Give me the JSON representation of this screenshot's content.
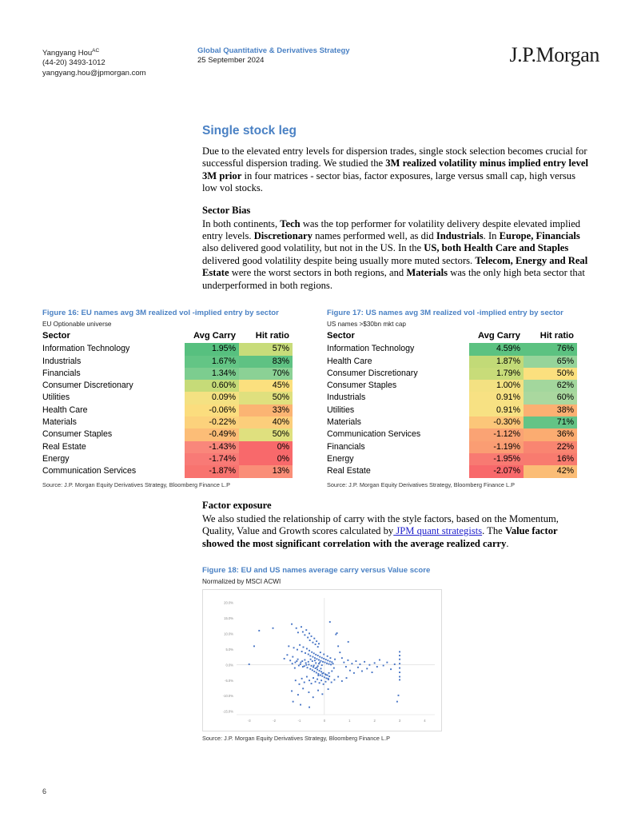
{
  "header": {
    "author_name": "Yangyang Hou",
    "author_sup": "AC",
    "phone": "(44-20) 3493-1012",
    "email": "yangyang.hou@jpmorgan.com",
    "strategy": "Global Quantitative & Derivatives Strategy",
    "date": "25 September 2024",
    "logo": "J.P.Morgan"
  },
  "content": {
    "section_title": "Single stock leg",
    "para1_a": "Due to the elevated entry levels for dispersion trades, single stock selection becomes crucial for successful dispersion trading. We studied the ",
    "para1_b": "3M realized volatility minus implied entry level 3M prior",
    "para1_c": " in four matrices - sector bias, factor exposures, large versus small cap, high versus low vol stocks.",
    "sector_bias_heading": "Sector Bias",
    "sb_1": "In both continents, ",
    "sb_2": "Tech",
    "sb_3": " was the top performer for volatility delivery despite elevated implied entry levels. ",
    "sb_4": "Discretionary",
    "sb_5": " names performed well, as did ",
    "sb_6": "Industrials",
    "sb_7": ". In ",
    "sb_8": "Europe, Financials",
    "sb_9": " also delivered good volatility, but not in the US. In the ",
    "sb_10": "US, both Health Care and Staples",
    "sb_11": " delivered good volatility despite being usually more muted sectors. ",
    "sb_12": "Telecom, Energy and Real Estate",
    "sb_13": " were the worst sectors in both regions, and ",
    "sb_14": "Materials",
    "sb_15": " was the only high beta sector that underperformed in both regions.",
    "factor_heading": "Factor exposure",
    "fe_1": "We also studied the relationship of carry with the style factors, based on the Momentum, Quality, Value and Growth scores calculated by",
    "fe_link": " JPM quant strategists",
    "fe_2": ". The ",
    "fe_3": "Value factor showed the most significant correlation with the average realized carry",
    "fe_4": "."
  },
  "figure16": {
    "title": "Figure 16: EU names avg 3M realized vol -implied entry by sector",
    "subtitle": "EU Optionable universe",
    "source": "Source: J.P. Morgan Equity Derivatives Strategy, Bloomberg Finance L.P",
    "columns": [
      "Sector",
      "Avg Carry",
      "Hit ratio"
    ],
    "rows": [
      {
        "sector": "Information Technology",
        "carry": "1.95%",
        "hit": "57%",
        "carry_color": "#57c07f",
        "hit_color": "#c8dc7a"
      },
      {
        "sector": "Industrials",
        "carry": "1.67%",
        "hit": "83%",
        "carry_color": "#63c585",
        "hit_color": "#5fc283"
      },
      {
        "sector": "Financials",
        "carry": "1.34%",
        "hit": "70%",
        "carry_color": "#7ccd8f",
        "hit_color": "#8bd195"
      },
      {
        "sector": "Consumer Discretionary",
        "carry": "0.60%",
        "hit": "45%",
        "carry_color": "#c6db78",
        "hit_color": "#fbe07e"
      },
      {
        "sector": "Utilities",
        "carry": "0.09%",
        "hit": "50%",
        "carry_color": "#f4e182",
        "hit_color": "#dfe07e"
      },
      {
        "sector": "Health Care",
        "carry": "-0.06%",
        "hit": "33%",
        "carry_color": "#fbdd7e",
        "hit_color": "#fbb473"
      },
      {
        "sector": "Materials",
        "carry": "-0.22%",
        "hit": "40%",
        "carry_color": "#fcd27c",
        "hit_color": "#fcce7b"
      },
      {
        "sector": "Consumer Staples",
        "carry": "-0.49%",
        "hit": "50%",
        "carry_color": "#fcbd77",
        "hit_color": "#dfe07e"
      },
      {
        "sector": "Real Estate",
        "carry": "-1.43%",
        "hit": "0%",
        "carry_color": "#f9877b",
        "hit_color": "#f8696b"
      },
      {
        "sector": "Energy",
        "carry": "-1.74%",
        "hit": "0%",
        "carry_color": "#f87a76",
        "hit_color": "#f8696b"
      },
      {
        "sector": "Communication Services",
        "carry": "-1.87%",
        "hit": "13%",
        "carry_color": "#f8736f",
        "hit_color": "#fa8e78"
      }
    ]
  },
  "figure17": {
    "title": "Figure 17: US names avg 3M realized vol -implied entry by sector",
    "subtitle": "US names >$30bn mkt cap",
    "source": "Source: J.P. Morgan Equity Derivatives Strategy, Bloomberg Finance L.P",
    "columns": [
      "Sector",
      "Avg Carry",
      "Hit ratio"
    ],
    "rows": [
      {
        "sector": "Information Technology",
        "carry": "4.59%",
        "hit": "76%",
        "carry_color": "#5cc281",
        "hit_color": "#5cc281"
      },
      {
        "sector": "Health Care",
        "carry": "1.87%",
        "hit": "65%",
        "carry_color": "#c2da77",
        "hit_color": "#96d49a"
      },
      {
        "sector": "Consumer Discretionary",
        "carry": "1.79%",
        "hit": "50%",
        "carry_color": "#c8dc79",
        "hit_color": "#fbe07e"
      },
      {
        "sector": "Consumer Staples",
        "carry": "1.00%",
        "hit": "62%",
        "carry_color": "#f3e182",
        "hit_color": "#a3d79d"
      },
      {
        "sector": "Industrials",
        "carry": "0.91%",
        "hit": "60%",
        "carry_color": "#f7e183",
        "hit_color": "#aad89f"
      },
      {
        "sector": "Utilities",
        "carry": "0.91%",
        "hit": "38%",
        "carry_color": "#f7e183",
        "hit_color": "#fbb072"
      },
      {
        "sector": "Materials",
        "carry": "-0.30%",
        "hit": "71%",
        "carry_color": "#fcc679",
        "hit_color": "#64c486"
      },
      {
        "sector": "Communication Services",
        "carry": "-1.12%",
        "hit": "36%",
        "carry_color": "#faa374",
        "hit_color": "#fbac71"
      },
      {
        "sector": "Financials",
        "carry": "-1.19%",
        "hit": "22%",
        "carry_color": "#fa9d73",
        "hit_color": "#f98571"
      },
      {
        "sector": "Energy",
        "carry": "-1.95%",
        "hit": "16%",
        "carry_color": "#f87a72",
        "hit_color": "#f87b6f"
      },
      {
        "sector": "Real Estate",
        "carry": "-2.07%",
        "hit": "42%",
        "carry_color": "#f8696b",
        "hit_color": "#fbbd76"
      }
    ]
  },
  "figure18": {
    "title": "Figure 18: EU and US names average carry versus Value score",
    "subtitle": "Normalized by MSCI ACWI",
    "source": "Source: J.P. Morgan Equity Derivatives Strategy, Bloomberg Finance L.P"
  },
  "chart_data": {
    "type": "scatter",
    "title": "Figure 18: EU and US names average carry versus Value score",
    "subtitle": "Normalized by MSCI ACWI",
    "xlabel": "",
    "ylabel": "",
    "xlim": [
      -3.5,
      4.4
    ],
    "ylim": [
      -0.16,
      0.215
    ],
    "xticks": [
      -3,
      -2,
      -1,
      0,
      1,
      2,
      3,
      4
    ],
    "xtick_labels": [
      "-3",
      "-2",
      "-1",
      "0",
      "1",
      "2",
      "3",
      "4"
    ],
    "yticks": [
      0.2,
      0.15,
      0.1,
      0.05,
      0.0,
      -0.05,
      -0.1,
      -0.15
    ],
    "ytick_labels": [
      "20.0%",
      "15.0%",
      "10.0%",
      "5.0%",
      "0.0%",
      "-5.0%",
      "-10.0%",
      "-15.0%"
    ],
    "grid": false,
    "marker_color": "#4472c4",
    "marker_size": 1.9,
    "legend": null,
    "series": [
      {
        "name": "Stocks",
        "points": [
          [
            -2.05,
            0.118
          ],
          [
            -1.3,
            0.131
          ],
          [
            -1.12,
            0.118
          ],
          [
            -1.05,
            0.104
          ],
          [
            -0.92,
            0.122
          ],
          [
            -0.86,
            0.106
          ],
          [
            -0.78,
            0.096
          ],
          [
            -0.72,
            0.112
          ],
          [
            -0.66,
            0.088
          ],
          [
            -0.6,
            0.101
          ],
          [
            -0.58,
            0.079
          ],
          [
            -0.52,
            0.092
          ],
          [
            -0.46,
            0.072
          ],
          [
            -0.4,
            0.085
          ],
          [
            -0.36,
            0.066
          ],
          [
            -0.31,
            0.076
          ],
          [
            -0.26,
            0.058
          ],
          [
            -0.22,
            0.068
          ],
          [
            0.22,
            0.138
          ],
          [
            0.46,
            0.098
          ],
          [
            -1.42,
            0.06
          ],
          [
            -1.22,
            0.055
          ],
          [
            -1.08,
            0.049
          ],
          [
            -0.98,
            0.064
          ],
          [
            -0.9,
            0.043
          ],
          [
            -0.84,
            0.057
          ],
          [
            -0.76,
            0.038
          ],
          [
            -0.7,
            0.052
          ],
          [
            -0.64,
            0.034
          ],
          [
            -0.6,
            0.046
          ],
          [
            -0.56,
            0.029
          ],
          [
            -0.5,
            0.041
          ],
          [
            -0.46,
            0.026
          ],
          [
            -0.42,
            0.037
          ],
          [
            -0.38,
            0.022
          ],
          [
            -0.34,
            0.033
          ],
          [
            -0.3,
            0.019
          ],
          [
            -0.26,
            0.03
          ],
          [
            -0.22,
            0.016
          ],
          [
            -0.18,
            0.026
          ],
          [
            -0.14,
            0.013
          ],
          [
            -0.1,
            0.023
          ],
          [
            -0.06,
            0.01
          ],
          [
            -0.02,
            0.02
          ],
          [
            0.02,
            0.008
          ],
          [
            0.06,
            0.017
          ],
          [
            0.1,
            0.005
          ],
          [
            0.14,
            0.014
          ],
          [
            0.18,
            0.003
          ],
          [
            0.22,
            0.011
          ],
          [
            0.26,
            0.001
          ],
          [
            0.3,
            0.009
          ],
          [
            -1.6,
            0.02
          ],
          [
            -1.48,
            0.032
          ],
          [
            -1.36,
            0.014
          ],
          [
            -1.26,
            0.026
          ],
          [
            -1.16,
            0.008
          ],
          [
            -1.06,
            0.018
          ],
          [
            -0.96,
            0.002
          ],
          [
            -0.88,
            0.012
          ],
          [
            -0.8,
            -0.004
          ],
          [
            -0.74,
            0.006
          ],
          [
            -0.68,
            -0.009
          ],
          [
            -0.62,
            0.001
          ],
          [
            -0.56,
            -0.013
          ],
          [
            -0.52,
            -0.003
          ],
          [
            -0.48,
            -0.017
          ],
          [
            -0.44,
            -0.007
          ],
          [
            -0.4,
            -0.021
          ],
          [
            -0.36,
            -0.011
          ],
          [
            -0.32,
            -0.025
          ],
          [
            -0.28,
            -0.015
          ],
          [
            -0.24,
            -0.029
          ],
          [
            -0.2,
            -0.019
          ],
          [
            -0.16,
            -0.033
          ],
          [
            -0.12,
            -0.022
          ],
          [
            -0.08,
            -0.036
          ],
          [
            -0.04,
            -0.026
          ],
          [
            0.0,
            -0.04
          ],
          [
            0.04,
            -0.03
          ],
          [
            0.08,
            -0.043
          ],
          [
            0.12,
            -0.033
          ],
          [
            0.16,
            -0.047
          ],
          [
            0.2,
            -0.037
          ],
          [
            -2.6,
            0.11
          ],
          [
            -2.8,
            0.06
          ],
          [
            -3.0,
            0.002
          ],
          [
            0.55,
            0.06
          ],
          [
            0.62,
            0.04
          ],
          [
            0.7,
            0.022
          ],
          [
            0.78,
            0.008
          ],
          [
            0.86,
            -0.006
          ],
          [
            0.94,
            0.015
          ],
          [
            1.02,
            -0.018
          ],
          [
            1.1,
            0.004
          ],
          [
            1.18,
            -0.026
          ],
          [
            1.26,
            0.012
          ],
          [
            1.34,
            -0.008
          ],
          [
            1.42,
            0.002
          ],
          [
            1.5,
            -0.02
          ],
          [
            1.6,
            0.01
          ],
          [
            1.7,
            -0.012
          ],
          [
            1.8,
            0.0
          ],
          [
            1.9,
            -0.024
          ],
          [
            2.0,
            0.006
          ],
          [
            2.1,
            -0.006
          ],
          [
            2.2,
            0.016
          ],
          [
            2.35,
            -0.002
          ],
          [
            2.5,
            0.008
          ],
          [
            2.65,
            -0.014
          ],
          [
            2.8,
            0.002
          ],
          [
            3.0,
            0.042
          ],
          [
            3.0,
            0.03
          ],
          [
            3.0,
            0.018
          ],
          [
            3.0,
            0.004
          ],
          [
            3.0,
            -0.01
          ],
          [
            3.0,
            -0.024
          ],
          [
            3.0,
            -0.038
          ],
          [
            3.0,
            -0.048
          ],
          [
            0.5,
            0.102
          ],
          [
            0.95,
            0.074
          ],
          [
            -1.15,
            -0.05
          ],
          [
            -1.0,
            -0.062
          ],
          [
            -0.9,
            -0.044
          ],
          [
            -0.8,
            -0.056
          ],
          [
            -0.7,
            -0.038
          ],
          [
            -0.6,
            -0.05
          ],
          [
            -0.52,
            -0.06
          ],
          [
            -0.44,
            -0.042
          ],
          [
            -0.36,
            -0.054
          ],
          [
            -0.28,
            -0.046
          ],
          [
            -0.2,
            -0.058
          ],
          [
            -0.12,
            -0.05
          ],
          [
            -0.04,
            -0.062
          ],
          [
            0.05,
            -0.054
          ],
          [
            0.15,
            -0.044
          ],
          [
            0.28,
            -0.056
          ],
          [
            0.4,
            -0.048
          ],
          [
            0.55,
            -0.038
          ],
          [
            0.7,
            -0.052
          ],
          [
            0.88,
            -0.042
          ],
          [
            -1.3,
            -0.084
          ],
          [
            -1.05,
            -0.096
          ],
          [
            -0.85,
            -0.076
          ],
          [
            -0.62,
            -0.088
          ],
          [
            -0.45,
            -0.104
          ],
          [
            -0.25,
            -0.082
          ],
          [
            -0.08,
            -0.094
          ],
          [
            0.15,
            -0.078
          ],
          [
            -0.95,
            -0.128
          ],
          [
            -1.25,
            -0.118
          ],
          [
            -0.6,
            -0.136
          ],
          [
            2.95,
            -0.098
          ],
          [
            2.9,
            -0.118
          ],
          [
            -0.48,
            0.012
          ],
          [
            -0.42,
            -0.002
          ],
          [
            -0.34,
            0.006
          ],
          [
            -0.26,
            -0.004
          ],
          [
            -0.18,
            0.008
          ],
          [
            -0.1,
            -0.001
          ],
          [
            -0.55,
            0.018
          ],
          [
            -0.64,
            0.01
          ],
          [
            -0.72,
            0.0
          ],
          [
            -0.78,
            0.016
          ],
          [
            -0.86,
            -0.006
          ],
          [
            -0.94,
            0.008
          ],
          [
            -1.02,
            -0.002
          ],
          [
            -1.1,
            0.012
          ],
          [
            -1.18,
            -0.01
          ],
          [
            -1.28,
            0.004
          ],
          [
            -0.38,
            0.014
          ],
          [
            -0.3,
            -0.008
          ],
          [
            -0.22,
            0.004
          ],
          [
            -0.14,
            -0.012
          ],
          [
            0.34,
            0.004
          ],
          [
            0.38,
            -0.01
          ],
          [
            0.42,
            0.018
          ],
          [
            0.3,
            -0.02
          ],
          [
            0.24,
            0.022
          ],
          [
            0.18,
            -0.026
          ],
          [
            0.12,
            0.028
          ],
          [
            0.06,
            -0.032
          ],
          [
            -0.02,
            0.034
          ],
          [
            -0.08,
            -0.028
          ],
          [
            -0.16,
            0.04
          ],
          [
            -0.24,
            -0.034
          ]
        ]
      }
    ]
  },
  "footer": {
    "page_number": "6"
  }
}
